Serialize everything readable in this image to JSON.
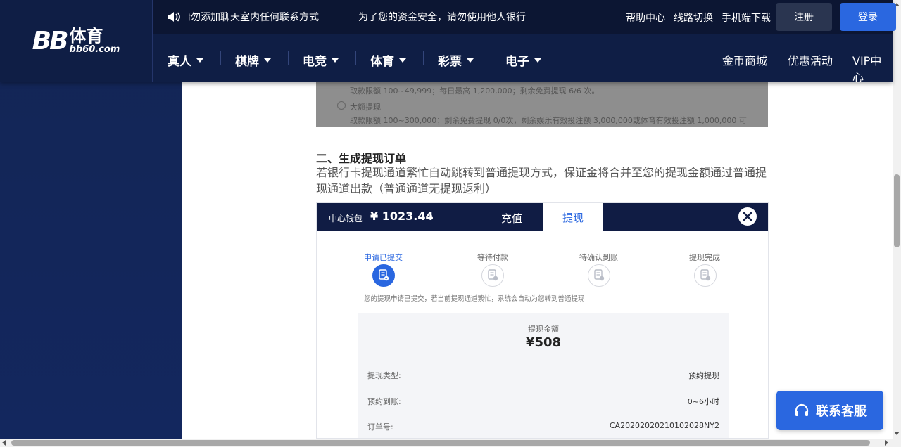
{
  "brand": {
    "logo_letters": "BB",
    "logo_cn": "体育",
    "logo_domain": "bb60.com"
  },
  "topbar": {
    "notices": [
      "请勿添加聊天室内任何联系方式",
      "为了您的资金安全，请勿使用他人银行"
    ],
    "links": [
      "帮助中心",
      "线路切换",
      "手机端下载"
    ],
    "register_label": "注册",
    "login_label": "登录"
  },
  "nav": {
    "items": [
      "真人",
      "棋牌",
      "电竞",
      "体育",
      "彩票",
      "电子"
    ],
    "right": [
      "金币商城",
      "优惠活动",
      "VIP中心"
    ]
  },
  "guide": {
    "prev_shot": {
      "line1": "取款限额 100~49,999；每日最高 1,200,000；剩余免费提现 6/6 次。",
      "option": "大额提现",
      "line2": "取款限额 100~300,000；剩余免费提现 0/0次，剩余娱乐有效投注额 3,000,000或体育有效投注额 1,000,000 可"
    },
    "section_title": "二、生成提现订单",
    "section_desc": "若银行卡提现通道繁忙自动跳转到普通提现方式，保证金将合并至您的提现金额通过普通提现通道出款（普通通道无提现返利）"
  },
  "panel": {
    "wallet_label": "中心钱包",
    "wallet_amount": "¥ 1023.44",
    "tab_deposit": "充值",
    "tab_withdraw": "提现",
    "steps": [
      "申请已提交",
      "等待付款",
      "待确认到账",
      "提现完成"
    ],
    "note": "您的提现申请已提交，若当前提现通道繁忙，系统会自动为您转到普通提现",
    "amount_label": "提现金额",
    "amount_value": "¥508",
    "rows": [
      {
        "label": "提现类型:",
        "value": "预约提现"
      },
      {
        "label": "预约到账:",
        "value": "0~6小时"
      },
      {
        "label": "订单号:",
        "value": "CA20202020210102028NY2"
      }
    ]
  },
  "support": {
    "label": "联系客服"
  },
  "colors": {
    "primary": "#2a67e0",
    "header_bg": "#0f1e45",
    "sidebar_bg": "#13255a"
  }
}
